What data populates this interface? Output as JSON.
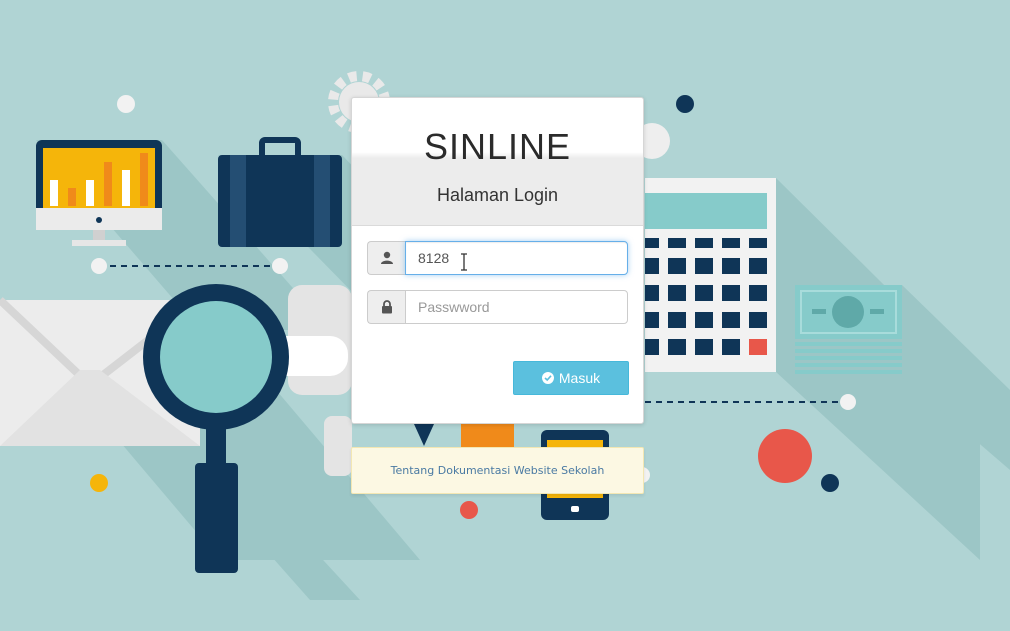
{
  "app": {
    "title": "SINLINE",
    "subtitle": "Halaman Login"
  },
  "form": {
    "username": {
      "value": "8128",
      "icon": "user-icon"
    },
    "password": {
      "value": "",
      "placeholder": "Passwword",
      "icon": "lock-icon"
    },
    "submit_label": "Masuk",
    "submit_icon": "check-circle-icon"
  },
  "info": {
    "link_text": "Tentang Dokumentasi Website Sekolah"
  },
  "colors": {
    "background": "#b0d4d4",
    "button": "#5bc0de",
    "info_box": "#fcf8e3",
    "link": "#4a7aa3"
  }
}
